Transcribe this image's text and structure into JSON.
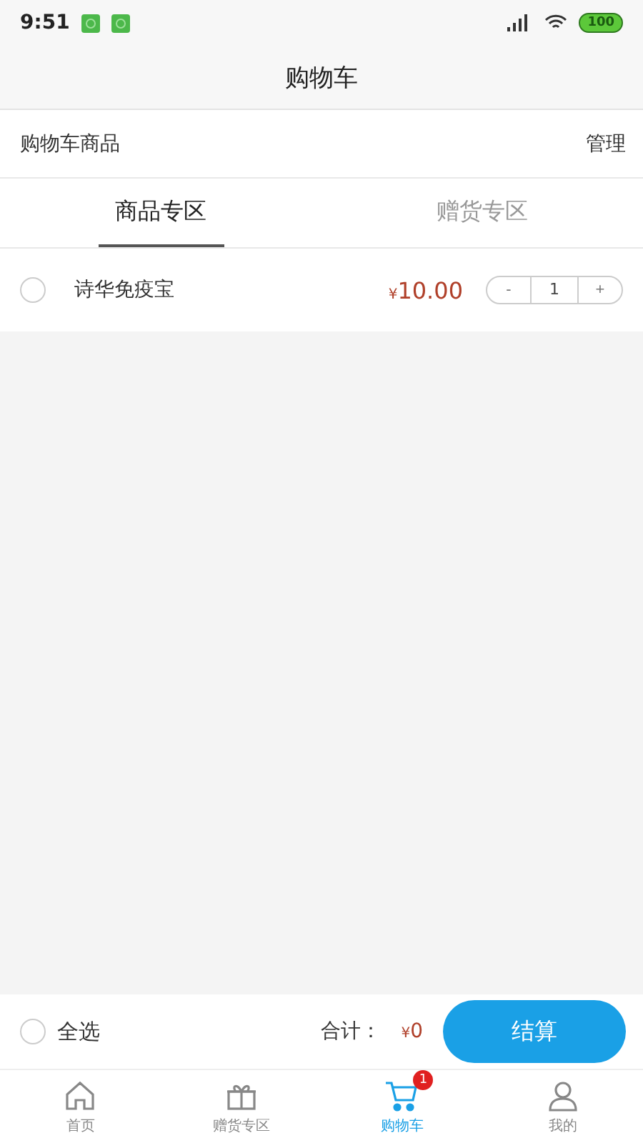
{
  "status_bar": {
    "time": "9:51",
    "battery": "100"
  },
  "header": {
    "title": "购物车"
  },
  "section": {
    "title": "购物车商品",
    "action": "管理"
  },
  "tabs": [
    {
      "label": "商品专区",
      "selected": true
    },
    {
      "label": "赠货专区",
      "selected": false
    }
  ],
  "items": [
    {
      "name": "诗华免疫宝",
      "checked": false,
      "currency": "¥",
      "price": "10.00",
      "quantity": "1",
      "minus": "-",
      "plus": "+"
    }
  ],
  "footer": {
    "select_all": "全选",
    "select_all_checked": false,
    "total_label": "合计：",
    "currency": "¥",
    "total": "0",
    "checkout": "结算"
  },
  "nav": [
    {
      "label": "首页",
      "kind": "home",
      "selected": false
    },
    {
      "label": "赠货专区",
      "kind": "gift",
      "selected": false
    },
    {
      "label": "购物车",
      "kind": "cart",
      "selected": true,
      "badge": "1"
    },
    {
      "label": "我的",
      "kind": "user",
      "selected": false
    }
  ]
}
